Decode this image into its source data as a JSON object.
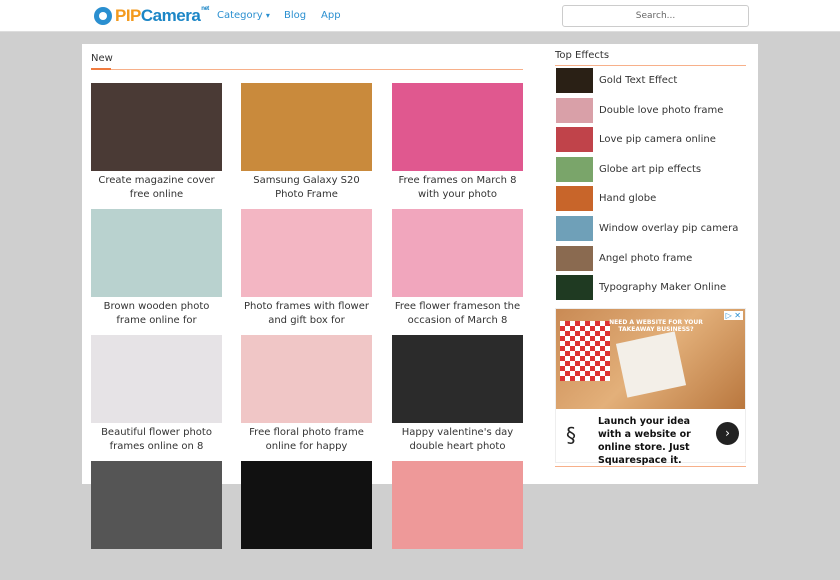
{
  "header": {
    "logo_pip": "PIP",
    "logo_camera": "Camera",
    "logo_suffix": "net",
    "nav": [
      "Category",
      "Blog",
      "App"
    ],
    "category_caret": "▾",
    "search_placeholder": "Search..."
  },
  "main": {
    "title": "New",
    "cards": [
      {
        "caption": "Create magazine cover free online",
        "color": "#4a3a35"
      },
      {
        "caption": "Samsung Galaxy S20 Photo Frame",
        "color": "#c98a3c"
      },
      {
        "caption": "Free frames on March 8 with your photo",
        "color": "#e0588f"
      },
      {
        "caption": "Brown wooden photo frame online for",
        "color": "#b9d2cf"
      },
      {
        "caption": "Photo frames with flower and gift box for",
        "color": "#f3b6c3"
      },
      {
        "caption": "Free flower frameson the occasion of March 8",
        "color": "#f1a6bd"
      },
      {
        "caption": "Beautiful flower photo frames online on 8",
        "color": "#e6e3e6"
      },
      {
        "caption": "Free floral photo frame online for happy",
        "color": "#f0c6c6"
      },
      {
        "caption": "Happy valentine's day double heart photo",
        "color": "#2b2b2b"
      },
      {
        "caption": "",
        "color": "#555"
      },
      {
        "caption": "",
        "color": "#111"
      },
      {
        "caption": "",
        "color": "#e99"
      }
    ]
  },
  "sidebar": {
    "title": "Top Effects",
    "items": [
      {
        "label": "Gold Text Effect",
        "color": "#2a2015"
      },
      {
        "label": "Double love photo frame",
        "color": "#d9a0a8"
      },
      {
        "label": "Love pip camera online",
        "color": "#c0434a"
      },
      {
        "label": "Globe art pip effects",
        "color": "#7aa56a"
      },
      {
        "label": "Hand globe",
        "color": "#c8652a"
      },
      {
        "label": "Window overlay pip camera",
        "color": "#6fa0b8"
      },
      {
        "label": "Angel photo frame",
        "color": "#8a6a50"
      },
      {
        "label": "Typography Maker Online",
        "color": "#1f3a22"
      }
    ]
  },
  "ad": {
    "headline": "NEED A WEBSITE FOR YOUR TAKEAWAY BUSINESS?",
    "text": "Launch your idea with a website or online store. Just Squarespace it.",
    "close": "▷ ✕",
    "cta": "›"
  }
}
